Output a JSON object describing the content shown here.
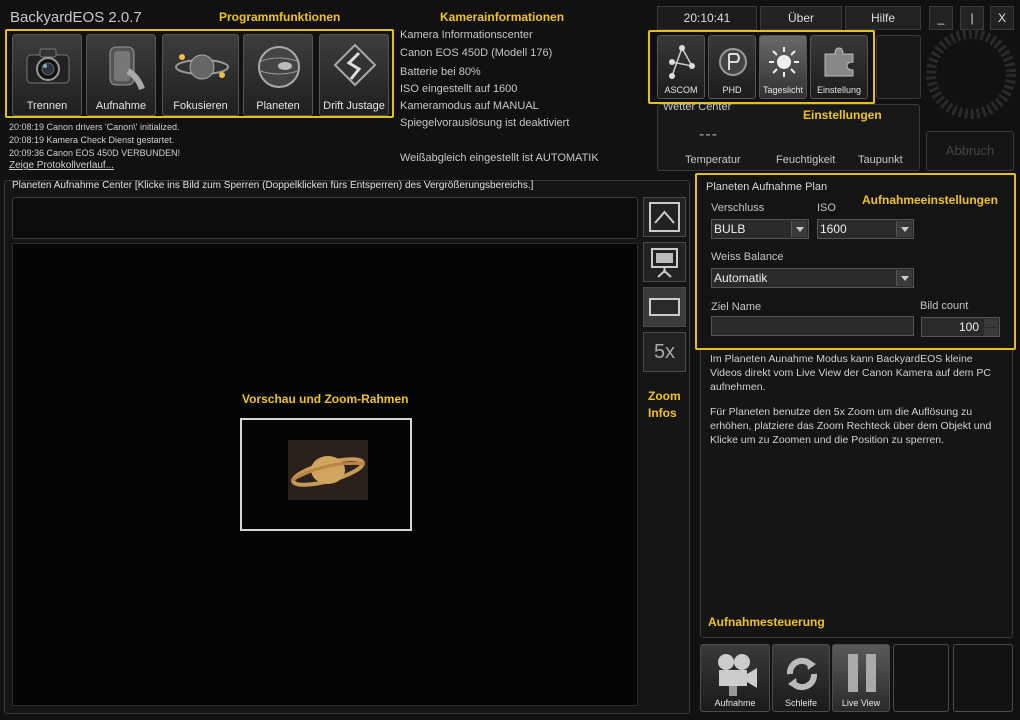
{
  "app": {
    "title": "BackyardEOS 2.0.7"
  },
  "annotations": {
    "programm": "Programmfunktionen",
    "kamera": "Kamerainformationen",
    "einstellungen": "Einstellungen",
    "aufnahmeeinstellungen": "Aufnahmeeinstellungen",
    "vorschau": "Vorschau und Zoom-Rahmen",
    "zoom": "Zoom",
    "infos": "Infos",
    "aufnahmesteuerung": "Aufnahmesteuerung"
  },
  "toolbar": {
    "buttons": [
      {
        "label": "Trennen",
        "icon": "camera-icon"
      },
      {
        "label": "Aufnahme",
        "icon": "film-roll-icon"
      },
      {
        "label": "Fokusieren",
        "icon": "planet-focus-icon"
      },
      {
        "label": "Planeten",
        "icon": "planet-icon"
      },
      {
        "label": "Drift Justage",
        "icon": "drift-icon"
      }
    ]
  },
  "log": {
    "lines": [
      "20:08:19  Canon drivers 'Canon\\' initialized.",
      "20:08:19  Kamera Check Dienst gestartet.",
      "20:09:36  Canon EOS 450D VERBUNDEN!"
    ],
    "link": "Zeige Protokollverlauf..."
  },
  "camera_info": {
    "header": "Kamera Informationscenter",
    "model": "Canon EOS 450D   (Modell 176)",
    "battery": "Batterie bei 80%",
    "iso": "ISO eingestellt auf 1600",
    "mode": "Kameramodus auf MANUAL",
    "mirror": "Spiegelvorauslösung ist deaktiviert",
    "wb": "Weißabgleich eingestellt ist AUTOMATIK"
  },
  "header_right": {
    "clock": "20:10:41",
    "about": "Über",
    "help": "Hilfe",
    "minimize": "_",
    "restore": "|",
    "close": "X"
  },
  "settings": {
    "buttons": [
      {
        "label": "ASCOM",
        "icon": "ascom-icon"
      },
      {
        "label": "PHD",
        "icon": "phd-icon"
      },
      {
        "label": "Tageslicht",
        "icon": "sun-icon"
      },
      {
        "label": "Einstellung",
        "icon": "puzzle-icon"
      }
    ]
  },
  "weather": {
    "title": "Wetter Center",
    "value": "---",
    "temperature": "Temperatur",
    "humidity": "Feuchtigkeit",
    "dewpoint": "Taupunkt"
  },
  "abort": "Abbruch",
  "capture_center": {
    "title": "Planeten Aufnahme Center   [Klicke ins Bild zum Sperren (Doppelklicken fürs Entsperren) des Vergrößerungsbereichs.]",
    "zoom_label": "5x"
  },
  "plan": {
    "title": "Planeten Aufnahme Plan",
    "shutter_label": "Verschluss",
    "shutter_value": "BULB",
    "iso_label": "ISO",
    "iso_value": "1600",
    "wb_label": "Weiss Balance",
    "wb_value": "Automatik",
    "target_label": "Ziel Name",
    "target_value": "",
    "count_label": "Bild count",
    "count_value": "100",
    "info1": "Im Planeten Aunahme Modus kann BackyardEOS kleine Videos direkt vom Live View der Canon Kamera auf dem PC aufnehmen.",
    "info2": "Für Planeten benutze den 5x Zoom um die Auflösung zu erhöhen, platziere das Zoom Rechteck über dem Objekt und Klicke um zu Zoomen und die Position zu sperren."
  },
  "controls": {
    "record": "Aufnahme",
    "loop": "Schleife",
    "liveview": "Live View"
  }
}
